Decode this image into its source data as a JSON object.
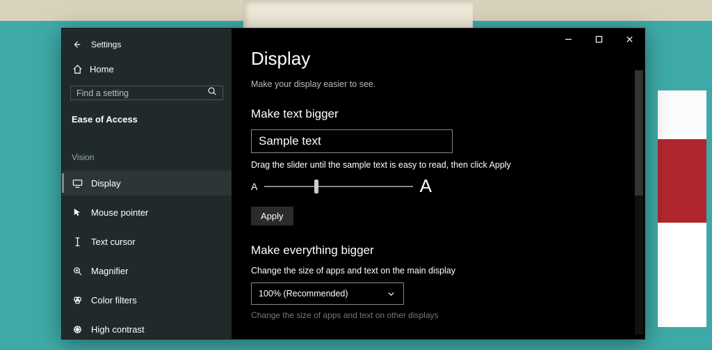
{
  "window": {
    "app_title": "Settings"
  },
  "sidebar": {
    "home_label": "Home",
    "search_placeholder": "Find a setting",
    "section_header": "Ease of Access",
    "group_label": "Vision",
    "items": [
      {
        "label": "Display"
      },
      {
        "label": "Mouse pointer"
      },
      {
        "label": "Text cursor"
      },
      {
        "label": "Magnifier"
      },
      {
        "label": "Color filters"
      },
      {
        "label": "High contrast"
      }
    ]
  },
  "main": {
    "title": "Display",
    "subtitle": "Make your display easier to see.",
    "section1": {
      "title": "Make text bigger",
      "sample_text": "Sample text",
      "slider_hint": "Drag the slider until the sample text is easy to read, then click Apply",
      "small_a": "A",
      "big_a": "A",
      "apply_label": "Apply"
    },
    "section2": {
      "title": "Make everything bigger",
      "desc": "Change the size of apps and text on the main display",
      "combo_value": "100% (Recommended)",
      "footnote": "Change the size of apps and text on other displays"
    }
  }
}
